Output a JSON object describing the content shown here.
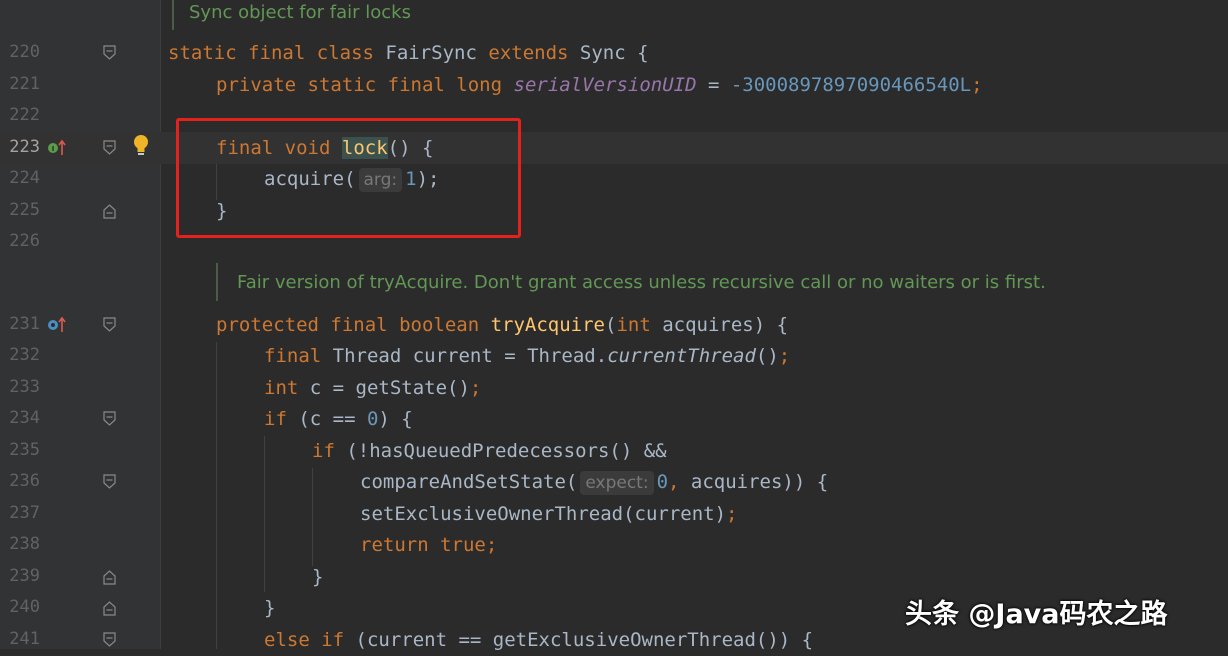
{
  "editor": {
    "doc_comments": {
      "sync_object": "Sync object for fair locks",
      "fair_version": "Fair version of tryAcquire. Don't grant access unless recursive call or no waiters or is first."
    },
    "lines": [
      {
        "num": "220",
        "tokens": [
          "static",
          "final",
          "class",
          "FairSync",
          "extends",
          "Sync {"
        ]
      },
      {
        "num": "221",
        "tokens": [
          "private",
          "static",
          "final",
          "long",
          "serialVersionUID",
          " = ",
          "-3000897897090466540L",
          ";"
        ]
      },
      {
        "num": "222"
      },
      {
        "num": "223",
        "tokens": [
          "final",
          "void",
          "lock",
          "() {"
        ]
      },
      {
        "num": "224",
        "tokens": [
          "acquire(",
          "arg:",
          "1",
          ");"
        ]
      },
      {
        "num": "225",
        "tokens": [
          "}"
        ]
      },
      {
        "num": "226"
      },
      {
        "num": "231",
        "tokens": [
          "protected",
          "final",
          "boolean",
          "tryAcquire",
          "(",
          "int",
          " acquires) {"
        ]
      },
      {
        "num": "232",
        "tokens": [
          "final",
          " Thread current = Thread.",
          "currentThread",
          "()",
          ";"
        ]
      },
      {
        "num": "233",
        "tokens": [
          "int",
          " c = getState()",
          ";"
        ]
      },
      {
        "num": "234",
        "tokens": [
          "if",
          " (c == ",
          "0",
          ") {"
        ]
      },
      {
        "num": "235",
        "tokens": [
          "if",
          " (!hasQueuedPredecessors() &&"
        ]
      },
      {
        "num": "236",
        "tokens": [
          "compareAndSetState(",
          "expect:",
          "0",
          ", ",
          "acquires)) {"
        ]
      },
      {
        "num": "237",
        "tokens": [
          "setExclusiveOwnerThread(current)",
          ";"
        ]
      },
      {
        "num": "238",
        "tokens": [
          "return",
          " true",
          ";"
        ]
      },
      {
        "num": "239",
        "tokens": [
          "}"
        ]
      },
      {
        "num": "240",
        "tokens": [
          "}"
        ]
      },
      {
        "num": "241",
        "tokens": [
          "else",
          " if",
          " (current == getExclusiveOwnerThread()) {"
        ]
      }
    ]
  },
  "watermark": "头条 @Java码农之路",
  "icons": {
    "fold": "fold-marker-icon",
    "override": "implements-method-icon",
    "bulb": "intention-bulb-icon"
  },
  "colors": {
    "background": "#2b2b2b",
    "keyword": "#cc7832",
    "method": "#ffc66d",
    "number": "#6897bb",
    "comment": "#629755",
    "highlight_box": "#e5211e"
  }
}
